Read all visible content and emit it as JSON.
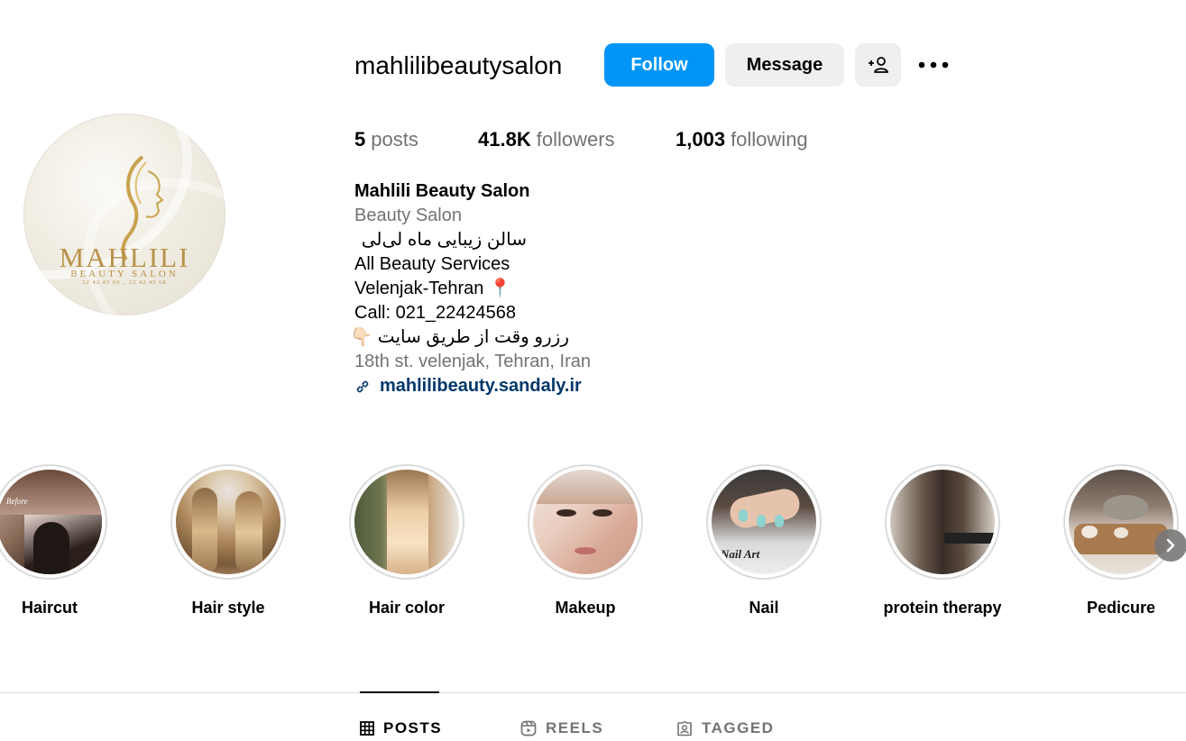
{
  "profile": {
    "username": "mahlilibeautysalon",
    "avatar": {
      "brand": "MAHLILI",
      "subtitle": "BEAUTY SALON",
      "phones": "22 42 45 69 _ 22 42 45 68"
    }
  },
  "actions": {
    "follow": "Follow",
    "message": "Message",
    "add_user_icon": "add-user-icon",
    "more_icon": "more-horizontal-icon"
  },
  "stats": [
    {
      "value": "5",
      "label": "posts"
    },
    {
      "value": "41.8K",
      "label": "followers"
    },
    {
      "value": "1,003",
      "label": "following"
    }
  ],
  "bio": {
    "name": "Mahlili Beauty Salon",
    "category": "Beauty Salon",
    "line_fa": "سالن زیبایی ماه لی‌لی",
    "services": "All Beauty Services",
    "location": "Velenjak-Tehran 📍",
    "call": "Call: 021_22424568",
    "booking_fa": "رزرو وقت از طریق سایت 👇🏻",
    "address": "18th st. velenjak, Tehran, Iran",
    "link": "mahlilibeauty.sandaly.ir"
  },
  "highlights": [
    {
      "label": "Haircut"
    },
    {
      "label": "Hair style"
    },
    {
      "label": "Hair color"
    },
    {
      "label": "Makeup"
    },
    {
      "label": "Nail"
    },
    {
      "label": "protein therapy"
    },
    {
      "label": "Pedicure"
    }
  ],
  "highlight_thumbs": {
    "haircut_text": "Before",
    "nail_text": "Nail Art"
  },
  "tabs": [
    {
      "label": "POSTS",
      "icon": "grid-icon",
      "active": true
    },
    {
      "label": "REELS",
      "icon": "reels-icon",
      "active": false
    },
    {
      "label": "TAGGED",
      "icon": "tagged-icon",
      "active": false
    }
  ],
  "colors": {
    "follow_bg": "#0095f6",
    "secondary_bg": "#efefef",
    "muted_text": "#737373",
    "link": "#00376b",
    "brand_gold": "#b8924a"
  }
}
